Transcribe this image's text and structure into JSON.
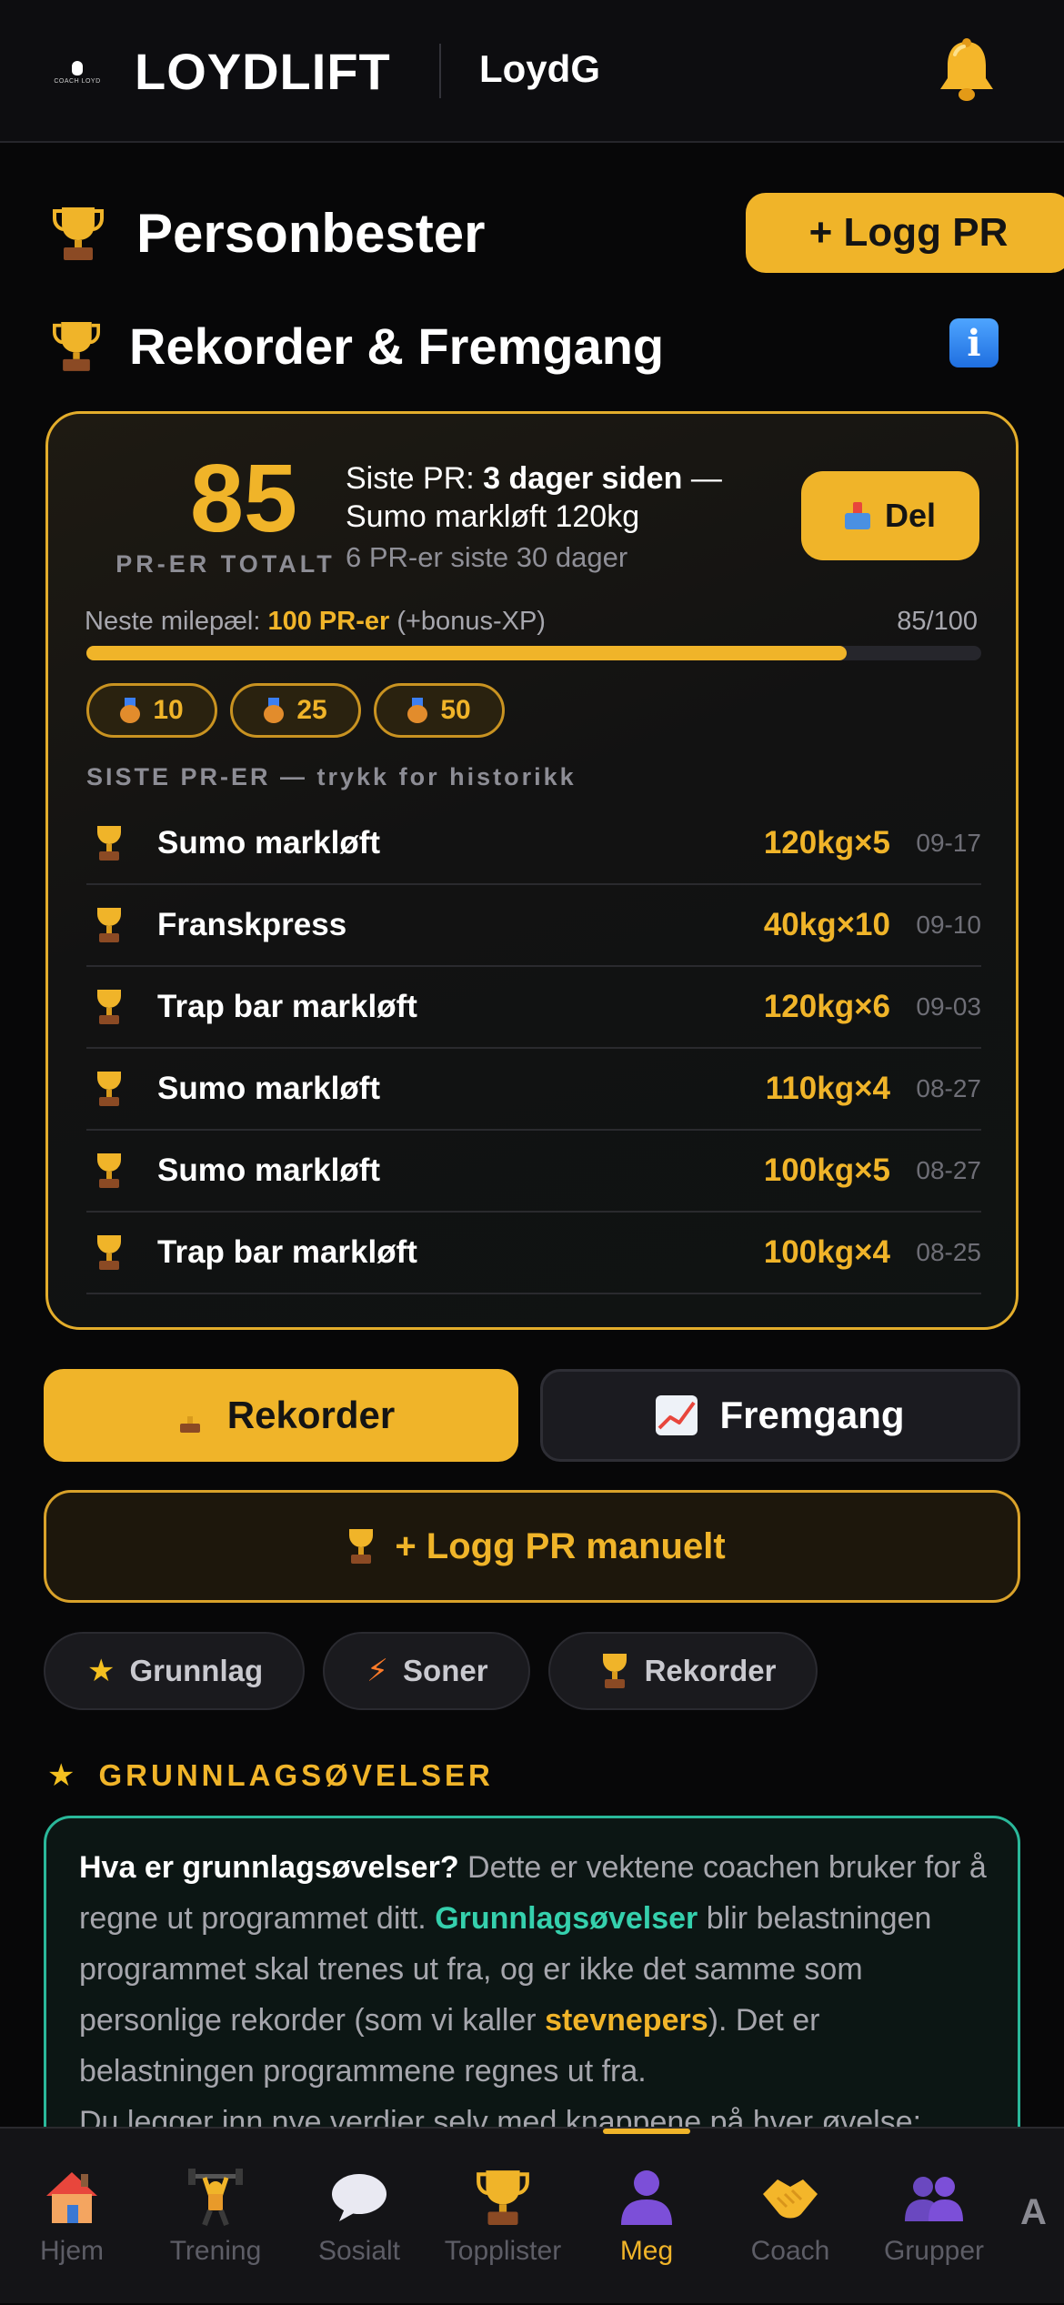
{
  "header": {
    "logo_text": "COACH LOYD",
    "brand": "LOYDLIFT",
    "username": "LoydG"
  },
  "page": {
    "title": "Personbester",
    "log_pr_button": "+ Logg PR",
    "section_title": "Rekorder & Fremgang",
    "info_icon": "i"
  },
  "summary": {
    "total": "85",
    "total_label": "PR-ER TOTALT",
    "last_pr_prefix": "Siste PR: ",
    "last_pr_time": "3 dager siden",
    "last_pr_suffix": " — Sumo markløft 120kg",
    "last_30": "6 PR-er siste 30 dager",
    "share_button": "Del",
    "milestone_prefix": "Neste milepæl: ",
    "milestone_target": "100 PR-er",
    "milestone_suffix": " (+bonus-XP)",
    "milestone_count": "85/100",
    "progress_fraction": 0.85,
    "badges": [
      "10",
      "25",
      "50"
    ]
  },
  "recent": {
    "title": "SISTE PR-ER — trykk for historikk",
    "items": [
      {
        "name": "Sumo markløft",
        "value": "120kg×5",
        "date": "09-17"
      },
      {
        "name": "Franskpress",
        "value": "40kg×10",
        "date": "09-10"
      },
      {
        "name": "Trap bar markløft",
        "value": "120kg×6",
        "date": "09-03"
      },
      {
        "name": "Sumo markløft",
        "value": "110kg×4",
        "date": "08-27"
      },
      {
        "name": "Sumo markløft",
        "value": "100kg×5",
        "date": "08-27"
      },
      {
        "name": "Trap bar markløft",
        "value": "100kg×4",
        "date": "08-25"
      }
    ]
  },
  "tabs": {
    "records": "Rekorder",
    "progress": "Fremgang"
  },
  "manual_button": "+ Logg PR manuelt",
  "chips": [
    "Grunnlag",
    "Soner",
    "Rekorder"
  ],
  "grunnlag": {
    "title": "GRUNNLAGSØVELSER",
    "q": "Hva er grunnlagsøvelser?",
    "t1": " Dette er vektene coachen bruker for å regne ut programmet ditt. ",
    "teal": "Grunnlagsøvelser",
    "t2": " blir belastningen programmet skal trenes ut fra, og er ikke det samme som personlige rekorder (som vi kaller ",
    "gold": "stevnepers",
    "t3": "). Det er belastningen programmene regnes ut fra.",
    "t4": "Du legger inn nye verdier selv med knappene på hver øvelse:"
  },
  "nav": {
    "items": [
      "Hjem",
      "Trening",
      "Sosialt",
      "Topplister",
      "Meg",
      "Coach",
      "Grupper"
    ],
    "active": "Meg",
    "a11y": "A"
  },
  "icons": {
    "bell": "bell-icon",
    "trophy": "trophy-icon",
    "medal": "medal-icon",
    "share": "share-icon",
    "chart": "chart-icon",
    "star": "star-icon",
    "bolt": "bolt-icon"
  },
  "colors": {
    "accent": "#f0b429",
    "teal": "#35d0ad",
    "background": "#070708"
  }
}
